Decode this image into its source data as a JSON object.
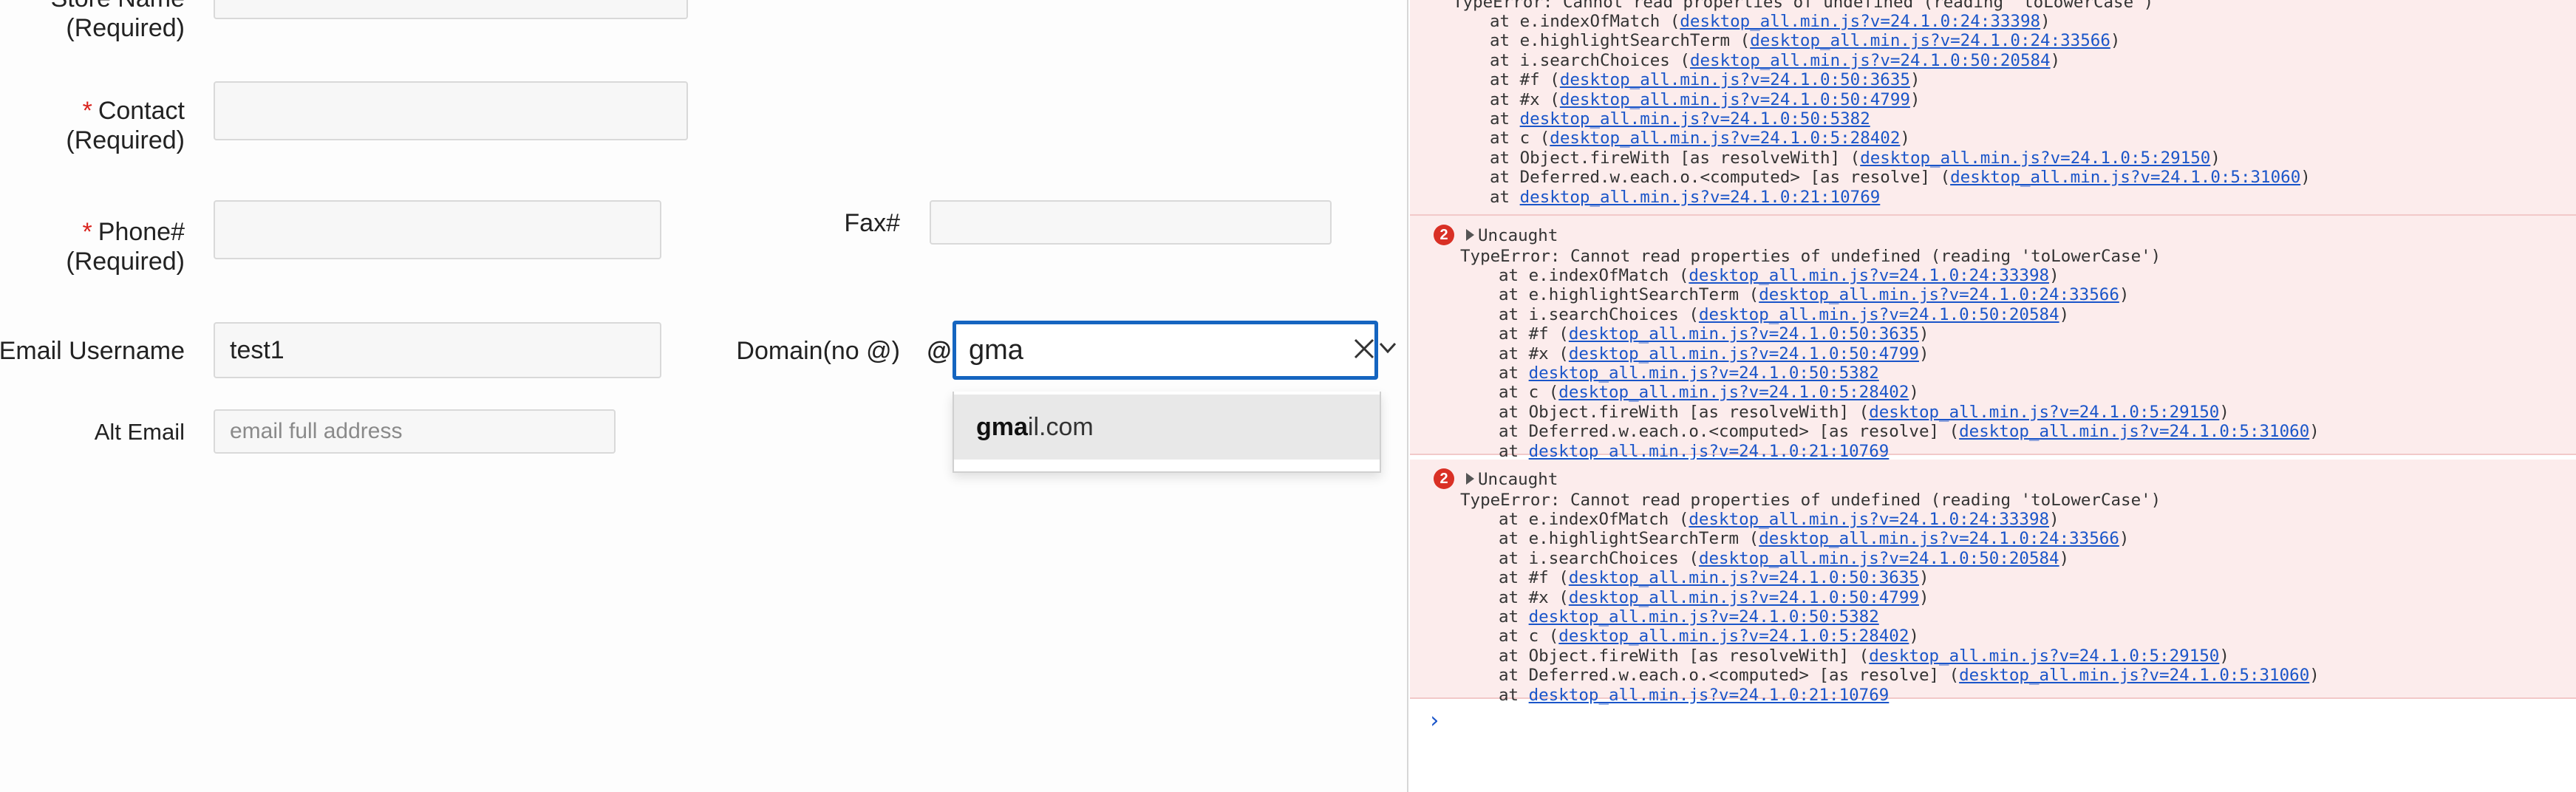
{
  "form": {
    "store_name_label": "Store Name",
    "store_name_required": "(Required)",
    "contact_label": "Contact",
    "contact_required": "(Required)",
    "phone_label": "Phone#",
    "phone_required": "(Required)",
    "required_marker": "*",
    "fax_label": "Fax#",
    "email_username_label": "Email Username",
    "email_username_value": "test1",
    "domain_label": "Domain(no @)",
    "at_symbol": "@",
    "domain_value": "gma",
    "domain_suggestion_match": "gma",
    "domain_suggestion_rest": "il.com",
    "alt_email_label": "Alt Email",
    "alt_email_placeholder": "email full address"
  },
  "console": {
    "count": "2",
    "uncaught": "Uncaught",
    "error_message": "TypeError: Cannot read properties of undefined (reading 'toLowerCase')",
    "frames": [
      {
        "fn": "at e.indexOfMatch (",
        "link": "desktop_all.min.js?v=24.1.0:24:33398",
        "end": ")"
      },
      {
        "fn": "at e.highlightSearchTerm (",
        "link": "desktop_all.min.js?v=24.1.0:24:33566",
        "end": ")"
      },
      {
        "fn": "at i.searchChoices (",
        "link": "desktop_all.min.js?v=24.1.0:50:20584",
        "end": ")"
      },
      {
        "fn": "at #f (",
        "link": "desktop_all.min.js?v=24.1.0:50:3635",
        "end": ")"
      },
      {
        "fn": "at #x (",
        "link": "desktop_all.min.js?v=24.1.0:50:4799",
        "end": ")"
      },
      {
        "fn": "at ",
        "link": "desktop_all.min.js?v=24.1.0:50:5382",
        "end": ""
      },
      {
        "fn": "at c (",
        "link": "desktop_all.min.js?v=24.1.0:5:28402",
        "end": ")"
      },
      {
        "fn": "at Object.fireWith [as resolveWith] (",
        "link": "desktop_all.min.js?v=24.1.0:5:29150",
        "end": ")"
      },
      {
        "fn": "at Deferred.w.each.o.<computed> [as resolve] (",
        "link": "desktop_all.min.js?v=24.1.0:5:31060",
        "end": ")"
      },
      {
        "fn": "at ",
        "link": "desktop_all.min.js?v=24.1.0:21:10769",
        "end": ""
      }
    ],
    "prompt": "›"
  },
  "colors": {
    "focus_border": "#1565c0",
    "error_bg": "#fcecec",
    "error_badge": "#d93025",
    "link": "#1a55c9",
    "required": "#d9231d"
  }
}
